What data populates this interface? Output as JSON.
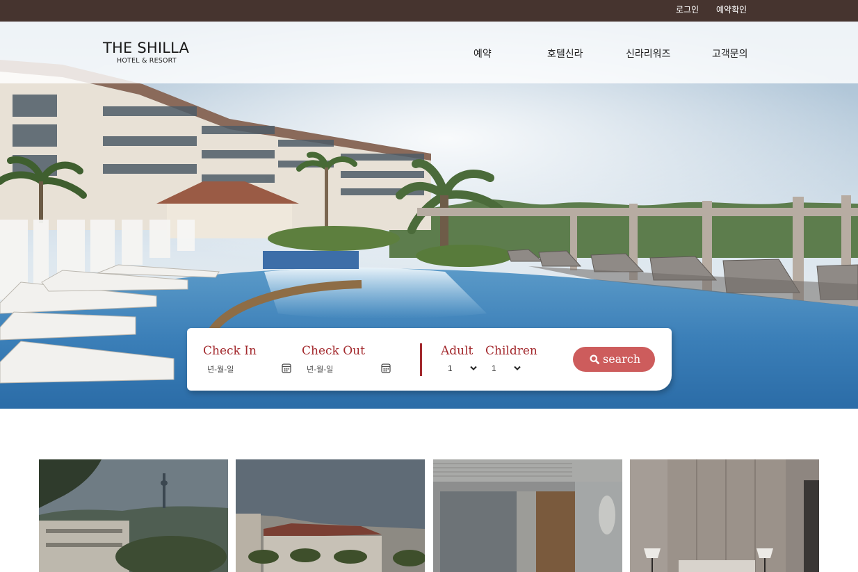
{
  "topbar": {
    "login": "로그인",
    "reservation_check": "예약확인"
  },
  "header": {
    "logo_brand": "THE SHILLA",
    "logo_sub": "HOTEL & RESORT",
    "nav": [
      "예약",
      "호텔신라",
      "신라리워즈",
      "고객문의"
    ]
  },
  "hero": {
    "image": "resort-pool-hero-image"
  },
  "booking": {
    "check_in_label": "Check In",
    "check_out_label": "Check Out",
    "date_placeholder": "년-월-일",
    "adult_label": "Adult",
    "children_label": "Children",
    "adult_value": "1",
    "children_value": "1",
    "search_label": "search",
    "accent_color": "#a3292d",
    "button_color": "#cd5c5c"
  },
  "gallery": {
    "cards": [
      "seoul-city-view-image",
      "jeju-resort-exterior-image",
      "hotel-room-window-image",
      "hotel-bedroom-image"
    ]
  },
  "icons": {
    "calendar": "calendar-icon",
    "chevron": "chevron-down-icon",
    "search": "search-icon"
  },
  "colors": {
    "topbar_bg": "#46342f"
  }
}
